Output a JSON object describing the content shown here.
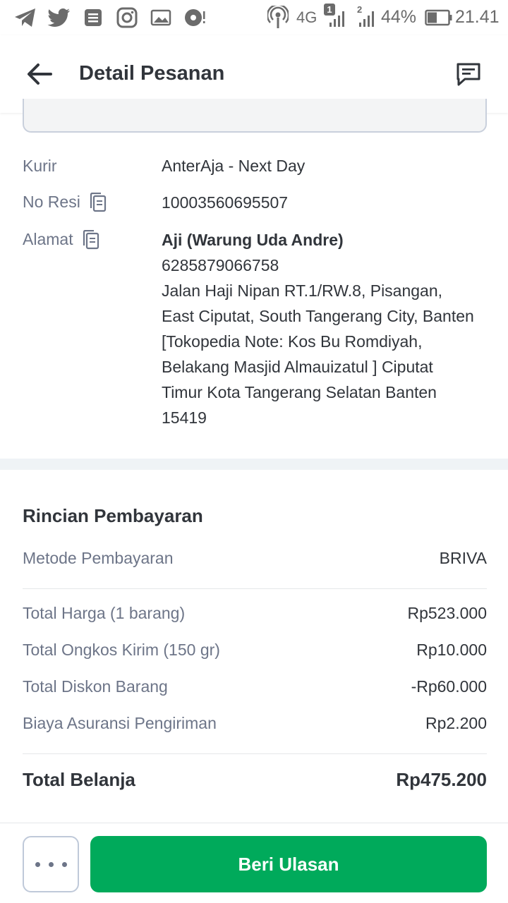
{
  "status_bar": {
    "network": "4G",
    "sim1_badge": "1",
    "sim2_badge": "2",
    "battery": "44%",
    "time": "21.41"
  },
  "header": {
    "title": "Detail Pesanan"
  },
  "shipping": {
    "courier_label": "Kurir",
    "courier_value": "AnterAja - Next Day",
    "receipt_label": "No Resi",
    "receipt_value": "10003560695507",
    "address_label": "Alamat",
    "address_name": "Aji (Warung Uda Andre)",
    "address_lines": [
      "6285879066758",
      "Jalan Haji Nipan RT.1/RW.8, Pisangan,",
      "East Ciputat, South Tangerang City, Banten",
      "[Tokopedia Note: Kos Bu Romdiyah,",
      "Belakang Masjid Almauizatul ] Ciputat",
      "Timur Kota Tangerang Selatan Banten",
      "15419"
    ]
  },
  "payment": {
    "title": "Rincian Pembayaran",
    "method_label": "Metode Pembayaran",
    "method_value": "BRIVA",
    "rows": [
      {
        "label": "Total Harga (1 barang)",
        "value": "Rp523.000"
      },
      {
        "label": "Total Ongkos Kirim (150 gr)",
        "value": "Rp10.000"
      },
      {
        "label": "Total Diskon Barang",
        "value": "-Rp60.000"
      },
      {
        "label": "Biaya Asuransi Pengiriman",
        "value": "Rp2.200"
      }
    ],
    "total_label": "Total Belanja",
    "total_value": "Rp475.200"
  },
  "bottom_bar": {
    "primary_label": "Beri Ulasan"
  },
  "colors": {
    "primary": "#00aa5b",
    "text": "#31353b",
    "muted": "#6d7588"
  }
}
